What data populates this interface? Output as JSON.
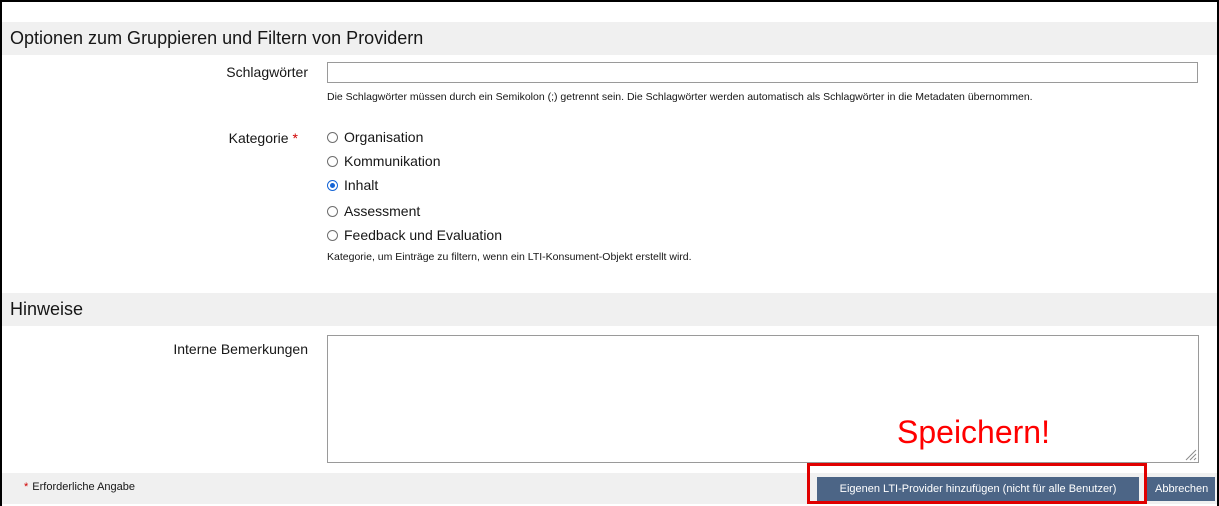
{
  "sections": {
    "filter_title": "Optionen zum Gruppieren und Filtern von Providern",
    "notes_title": "Hinweise"
  },
  "keywords": {
    "label": "Schlagwörter",
    "value": "",
    "help": "Die Schlagwörter müssen durch ein Semikolon (;) getrennt sein. Die Schlagwörter werden automatisch als Schlagwörter in die Metadaten übernommen."
  },
  "category": {
    "label": "Kategorie",
    "required_mark": "*",
    "options": [
      {
        "label": "Organisation",
        "checked": false
      },
      {
        "label": "Kommunikation",
        "checked": false
      },
      {
        "label": "Inhalt",
        "checked": true
      },
      {
        "label": "Assessment",
        "checked": false
      },
      {
        "label": "Feedback und Evaluation",
        "checked": false
      }
    ],
    "help": "Kategorie, um Einträge zu filtern, wenn ein LTI-Konsument-Objekt erstellt wird."
  },
  "internal_notes": {
    "label": "Interne Bemerkungen",
    "value": ""
  },
  "footer": {
    "required_mark": "*",
    "required_note": "Erforderliche Angabe",
    "add_button": "Eigenen LTI-Provider hinzufügen (nicht für alle Benutzer)",
    "cancel_button": "Abbrechen"
  },
  "annotation": {
    "text": "Speichern!",
    "color": "#ff0000"
  },
  "colors": {
    "button_bg": "#4c6586",
    "section_bg": "#f0f0f0",
    "radio_accent": "#1464d6",
    "required": "#d00000"
  }
}
